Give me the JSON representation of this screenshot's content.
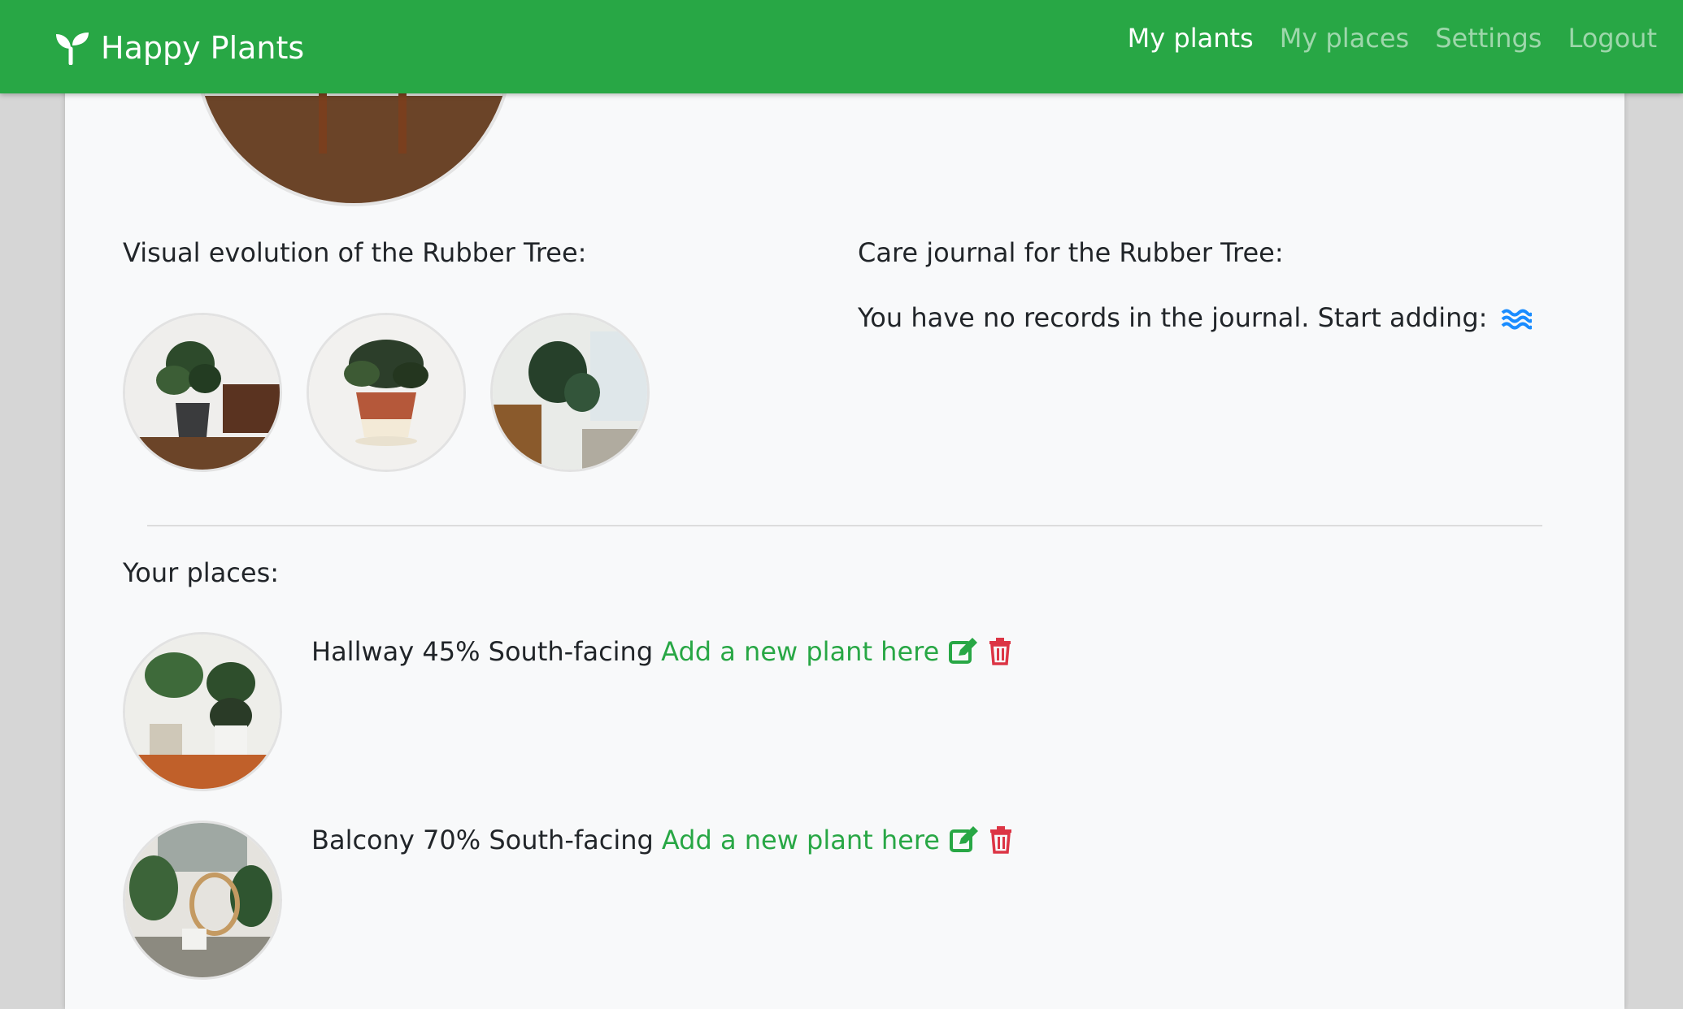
{
  "app": {
    "title": "Happy Plants"
  },
  "nav": {
    "items": [
      {
        "label": "My plants",
        "active": true
      },
      {
        "label": "My places",
        "active": false
      },
      {
        "label": "Settings",
        "active": false
      },
      {
        "label": "Logout",
        "active": false
      }
    ]
  },
  "plant": {
    "evolution_heading": "Visual evolution of the Rubber Tree:",
    "journal_heading": "Care journal for the Rubber Tree:",
    "journal_empty": "You have no records in the journal. Start adding:"
  },
  "places": {
    "heading": "Your places:",
    "items": [
      {
        "name": "Hallway",
        "light": "45%",
        "orientation": "South-facing",
        "add_link": "Add a new plant here"
      },
      {
        "name": "Balcony",
        "light": "70%",
        "orientation": "South-facing",
        "add_link": "Add a new plant here"
      }
    ]
  },
  "colors": {
    "brand": "#28a745",
    "danger": "#dc3545",
    "info": "#007bff",
    "text": "#212529"
  },
  "icons": {
    "brand": "seedling-icon",
    "journal_add": "water-icon",
    "edit": "edit-icon",
    "delete": "trash-icon"
  }
}
